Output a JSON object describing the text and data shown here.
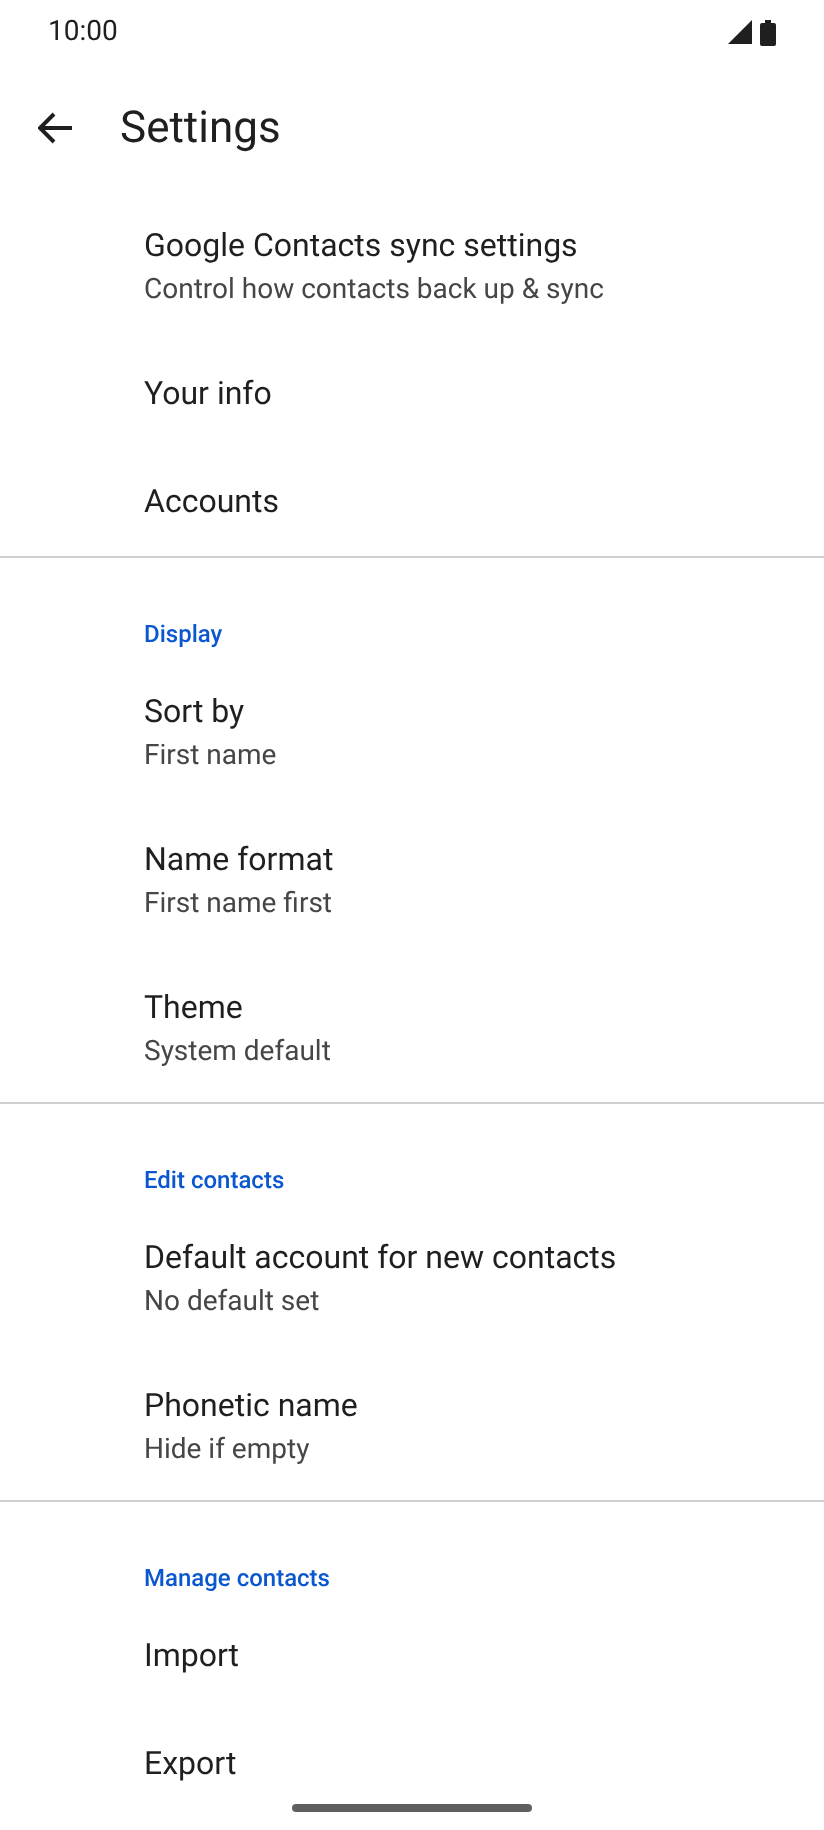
{
  "status_bar": {
    "time": "10:00"
  },
  "header": {
    "title": "Settings"
  },
  "sections": [
    {
      "items": [
        {
          "title": "Google Contacts sync settings",
          "subtitle": "Control how contacts back up & sync"
        },
        {
          "title": "Your info"
        },
        {
          "title": "Accounts"
        }
      ]
    },
    {
      "header": "Display",
      "items": [
        {
          "title": "Sort by",
          "subtitle": "First name"
        },
        {
          "title": "Name format",
          "subtitle": "First name first"
        },
        {
          "title": "Theme",
          "subtitle": "System default"
        }
      ]
    },
    {
      "header": "Edit contacts",
      "items": [
        {
          "title": "Default account for new contacts",
          "subtitle": "No default set"
        },
        {
          "title": "Phonetic name",
          "subtitle": "Hide if empty"
        }
      ]
    },
    {
      "header": "Manage contacts",
      "items": [
        {
          "title": "Import"
        },
        {
          "title": "Export"
        }
      ]
    }
  ]
}
